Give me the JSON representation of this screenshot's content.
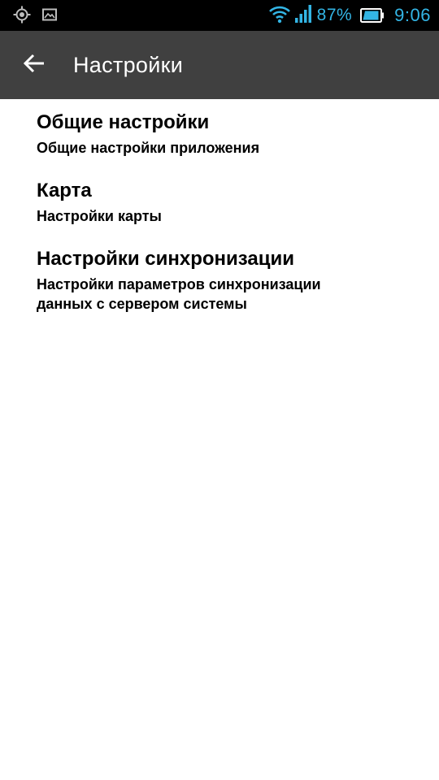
{
  "status_bar": {
    "icons_left": [
      "gps-icon",
      "image-notification-icon"
    ],
    "icons_right": [
      "wifi-icon",
      "signal-icon",
      "battery-icon"
    ],
    "battery_percent": "87%",
    "time": "9:06",
    "accent_color": "#33b5e5"
  },
  "action_bar": {
    "title": "Настройки",
    "back_icon": "arrow-left-icon",
    "background_color": "#404040"
  },
  "preferences": [
    {
      "title": "Общие настройки",
      "summary": "Общие настройки приложения"
    },
    {
      "title": "Карта",
      "summary": "Настройки карты"
    },
    {
      "title": "Настройки синхронизации",
      "summary": "Настройки параметров синхронизации данных с сервером системы"
    }
  ]
}
